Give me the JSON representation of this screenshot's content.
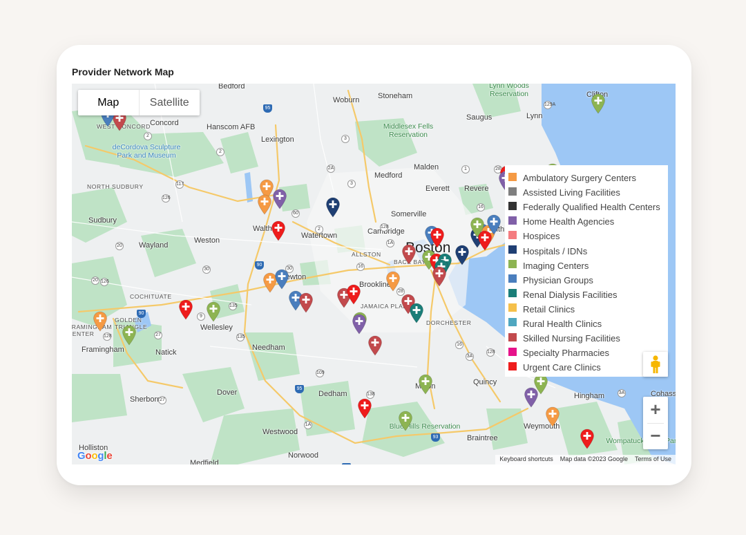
{
  "title": "Provider Network Map",
  "map_type": {
    "options": [
      "Map",
      "Satellite"
    ],
    "selected": "Map"
  },
  "legend": {
    "placement": "right",
    "items": [
      {
        "label": "Ambulatory Surgery Centers",
        "color": "#f59a44"
      },
      {
        "label": "Assisted Living Facilities",
        "color": "#7f7f7f"
      },
      {
        "label": "Federally Qualified Health Centers",
        "color": "#333333"
      },
      {
        "label": "Home Health Agencies",
        "color": "#8060a8"
      },
      {
        "label": "Hospices",
        "color": "#f47c80"
      },
      {
        "label": "Hospitals / IDNs",
        "color": "#1f3f73"
      },
      {
        "label": "Imaging Centers",
        "color": "#8db452"
      },
      {
        "label": "Physician Groups",
        "color": "#4a7ebd"
      },
      {
        "label": "Renal Dialysis Facilities",
        "color": "#1a7e78"
      },
      {
        "label": "Retail Clinics",
        "color": "#f5c04a"
      },
      {
        "label": "Rural Health Clinics",
        "color": "#4fa7c0"
      },
      {
        "label": "Skilled Nursing Facilities",
        "color": "#c24a4d"
      },
      {
        "label": "Specialty Pharmacies",
        "color": "#e6128a"
      },
      {
        "label": "Urgent Care Clinics",
        "color": "#ee1c1c"
      }
    ]
  },
  "places": [
    {
      "name": "Bedford",
      "style": "med"
    },
    {
      "name": "Woburn",
      "style": "med"
    },
    {
      "name": "Stoneham",
      "style": "med"
    },
    {
      "name": "Lynn Woods Reservation",
      "style": "green"
    },
    {
      "name": "Clifton",
      "style": "med"
    },
    {
      "name": "WEST CONCORD",
      "style": "caps"
    },
    {
      "name": "Concord",
      "style": "med"
    },
    {
      "name": "Hanscom AFB",
      "style": "med"
    },
    {
      "name": "Saugus",
      "style": "med"
    },
    {
      "name": "Lynn",
      "style": "med"
    },
    {
      "name": "Middlesex Fells Reservation",
      "style": "green"
    },
    {
      "name": "deCordova Sculpture Park and Museum",
      "style": "blue"
    },
    {
      "name": "Lexington",
      "style": "med"
    },
    {
      "name": "Malden",
      "style": "med"
    },
    {
      "name": "Medford",
      "style": "med"
    },
    {
      "name": "Everett",
      "style": "med"
    },
    {
      "name": "Revere",
      "style": "med"
    },
    {
      "name": "NORTH SUDBURY",
      "style": "caps"
    },
    {
      "name": "Sudbury",
      "style": "med"
    },
    {
      "name": "Waltham",
      "style": "med"
    },
    {
      "name": "Watertown",
      "style": "med"
    },
    {
      "name": "Somerville",
      "style": "med"
    },
    {
      "name": "Cambridge",
      "style": "med"
    },
    {
      "name": "Winthrop",
      "style": "med"
    },
    {
      "name": "Wayland",
      "style": "med"
    },
    {
      "name": "Weston",
      "style": "med"
    },
    {
      "name": "Boston",
      "style": "big"
    },
    {
      "name": "ALLSTON",
      "style": "caps"
    },
    {
      "name": "BACK BAY",
      "style": "caps"
    },
    {
      "name": "Newton",
      "style": "med"
    },
    {
      "name": "Brookline",
      "style": "med"
    },
    {
      "name": "COCHITUATE",
      "style": "caps"
    },
    {
      "name": "JAMAICA PLAIN",
      "style": "caps"
    },
    {
      "name": "GOLDEN TRIANGLE",
      "style": "caps"
    },
    {
      "name": "FRAMINGHAM CENTER",
      "style": "caps"
    },
    {
      "name": "Wellesley",
      "style": "med"
    },
    {
      "name": "DORCHESTER",
      "style": "caps"
    },
    {
      "name": "Framingham",
      "style": "med"
    },
    {
      "name": "Natick",
      "style": "med"
    },
    {
      "name": "Needham",
      "style": "med"
    },
    {
      "name": "Quincy",
      "style": "med"
    },
    {
      "name": "Dover",
      "style": "med"
    },
    {
      "name": "Dedham",
      "style": "med"
    },
    {
      "name": "Milton",
      "style": "med"
    },
    {
      "name": "Hingham",
      "style": "med"
    },
    {
      "name": "Cohasset",
      "style": "med"
    },
    {
      "name": "Sherborn",
      "style": "med"
    },
    {
      "name": "Blue Hills Reservation",
      "style": "green"
    },
    {
      "name": "Weymouth",
      "style": "med"
    },
    {
      "name": "Westwood",
      "style": "med"
    },
    {
      "name": "Braintree",
      "style": "med"
    },
    {
      "name": "Wompatuck State Park",
      "style": "green"
    },
    {
      "name": "Holliston",
      "style": "med"
    },
    {
      "name": "Norwood",
      "style": "med"
    },
    {
      "name": "Medfield",
      "style": "med"
    }
  ],
  "highways": [
    "95",
    "2",
    "2",
    "3",
    "129A",
    "2A",
    "3",
    "128",
    "1",
    "117",
    "28",
    "16",
    "126",
    "60",
    "2",
    "20",
    "1A",
    "93",
    "20",
    "30",
    "30",
    "90",
    "16",
    "9",
    "126",
    "27",
    "135",
    "28",
    "3A",
    "109",
    "95",
    "1A",
    "138",
    "3A",
    "93",
    "128",
    "27",
    "135",
    "95",
    "128",
    "90",
    "16"
  ],
  "attribution": {
    "logo": "Google",
    "shortcuts": "Keyboard shortcuts",
    "map_data": "Map data ©2023 Google",
    "terms": "Terms of Use"
  },
  "controls": {
    "zoom_in": "+",
    "zoom_out": "−",
    "street_view": "pegman-icon"
  },
  "markers": [
    {
      "lat": 42.458,
      "lng": -71.391,
      "category": "Skilled Nursing Facilities"
    },
    {
      "lat": 42.462,
      "lng": -71.402,
      "category": "Physician Groups"
    },
    {
      "lat": 42.391,
      "lng": -71.256,
      "category": "Ambulatory Surgery Centers"
    },
    {
      "lat": 42.381,
      "lng": -71.244,
      "category": "Home Health Agencies"
    },
    {
      "lat": 42.376,
      "lng": -71.258,
      "category": "Ambulatory Surgery Centers"
    },
    {
      "lat": 42.373,
      "lng": -71.195,
      "category": "Hospitals / IDNs"
    },
    {
      "lat": 42.35,
      "lng": -71.245,
      "category": "Urgent Care Clinics"
    },
    {
      "lat": 42.345,
      "lng": -71.104,
      "category": "Physician Groups"
    },
    {
      "lat": 42.343,
      "lng": -71.099,
      "category": "Urgent Care Clinics"
    },
    {
      "lat": 42.327,
      "lng": -71.125,
      "category": "Skilled Nursing Facilities"
    },
    {
      "lat": 42.321,
      "lng": -71.107,
      "category": "Imaging Centers"
    },
    {
      "lat": 42.318,
      "lng": -71.1,
      "category": "Urgent Care Clinics"
    },
    {
      "lat": 42.318,
      "lng": -71.092,
      "category": "Renal Dialysis Facilities"
    },
    {
      "lat": 42.312,
      "lng": -71.095,
      "category": "Renal Dialysis Facilities"
    },
    {
      "lat": 42.305,
      "lng": -71.097,
      "category": "Skilled Nursing Facilities"
    },
    {
      "lat": 42.3,
      "lng": -71.14,
      "category": "Ambulatory Surgery Centers"
    },
    {
      "lat": 42.343,
      "lng": -71.062,
      "category": "Hospitals / IDNs"
    },
    {
      "lat": 42.347,
      "lng": -71.058,
      "category": "Physician Groups"
    },
    {
      "lat": 42.346,
      "lng": -71.052,
      "category": "Ambulatory Surgery Centers"
    },
    {
      "lat": 42.34,
      "lng": -71.055,
      "category": "Urgent Care Clinics"
    },
    {
      "lat": 42.353,
      "lng": -71.062,
      "category": "Imaging Centers"
    },
    {
      "lat": 42.356,
      "lng": -71.047,
      "category": "Physician Groups"
    },
    {
      "lat": 42.326,
      "lng": -71.076,
      "category": "Hospitals / IDNs"
    },
    {
      "lat": 42.404,
      "lng": -71.035,
      "category": "Urgent Care Clinics"
    },
    {
      "lat": 42.399,
      "lng": -71.036,
      "category": "Home Health Agencies"
    },
    {
      "lat": 42.406,
      "lng": -70.993,
      "category": "Imaging Centers"
    },
    {
      "lat": 42.475,
      "lng": -70.951,
      "category": "Imaging Centers"
    },
    {
      "lat": 42.299,
      "lng": -71.253,
      "category": "Ambulatory Surgery Centers"
    },
    {
      "lat": 42.302,
      "lng": -71.242,
      "category": "Physician Groups"
    },
    {
      "lat": 42.281,
      "lng": -71.229,
      "category": "Physician Groups"
    },
    {
      "lat": 42.279,
      "lng": -71.22,
      "category": "Skilled Nursing Facilities"
    },
    {
      "lat": 42.284,
      "lng": -71.185,
      "category": "Skilled Nursing Facilities"
    },
    {
      "lat": 42.287,
      "lng": -71.176,
      "category": "Urgent Care Clinics"
    },
    {
      "lat": 42.278,
      "lng": -71.126,
      "category": "Skilled Nursing Facilities"
    },
    {
      "lat": 42.269,
      "lng": -71.118,
      "category": "Renal Dialysis Facilities"
    },
    {
      "lat": 42.26,
      "lng": -71.17,
      "category": "Imaging Centers"
    },
    {
      "lat": 42.258,
      "lng": -71.171,
      "category": "Home Health Agencies"
    },
    {
      "lat": 42.237,
      "lng": -71.156,
      "category": "Skilled Nursing Facilities"
    },
    {
      "lat": 42.27,
      "lng": -71.305,
      "category": "Imaging Centers"
    },
    {
      "lat": 42.272,
      "lng": -71.33,
      "category": "Urgent Care Clinics"
    },
    {
      "lat": 42.261,
      "lng": -71.409,
      "category": "Ambulatory Surgery Centers"
    },
    {
      "lat": 42.247,
      "lng": -71.382,
      "category": "Imaging Centers"
    },
    {
      "lat": 42.199,
      "lng": -71.11,
      "category": "Imaging Centers"
    },
    {
      "lat": 42.175,
      "lng": -71.166,
      "category": "Urgent Care Clinics"
    },
    {
      "lat": 42.163,
      "lng": -71.128,
      "category": "Imaging Centers"
    },
    {
      "lat": 42.186,
      "lng": -71.013,
      "category": "Home Health Agencies"
    },
    {
      "lat": 42.199,
      "lng": -71.004,
      "category": "Imaging Centers"
    },
    {
      "lat": 42.167,
      "lng": -70.993,
      "category": "Ambulatory Surgery Centers"
    },
    {
      "lat": 42.145,
      "lng": -70.961,
      "category": "Urgent Care Clinics"
    }
  ]
}
